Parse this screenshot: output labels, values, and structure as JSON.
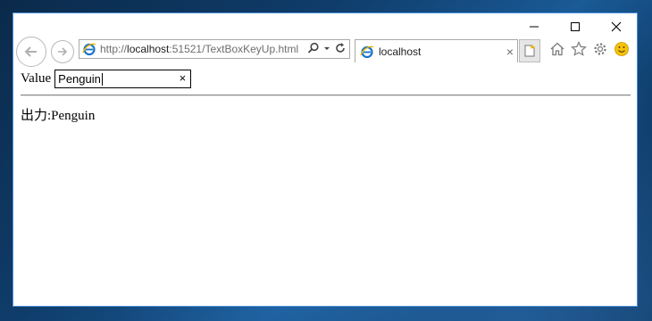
{
  "browser": {
    "address_prefix": "http://",
    "address_host": "localhost",
    "address_rest": ":51521/TextBoxKeyUp.html",
    "tab_title": "localhost",
    "tab_close": "×",
    "icons": [
      "back-arrow-icon",
      "forward-arrow-icon",
      "ie-logo-icon",
      "search-icon",
      "dropdown-icon",
      "refresh-icon",
      "new-tab-icon",
      "home-icon",
      "favorites-star-icon",
      "settings-gear-icon",
      "feedback-smiley-icon"
    ]
  },
  "window_controls": [
    "minimize-icon",
    "maximize-icon",
    "close-icon"
  ],
  "page": {
    "value_label": "Value",
    "input_value": "Penguin",
    "clear_glyph": "×",
    "output_label": "出力:",
    "output_value": "Penguin"
  },
  "colors": {
    "window_border": "#4a90d9",
    "ie_blue": "#1a73c9",
    "smiley": "#f4c20d"
  }
}
